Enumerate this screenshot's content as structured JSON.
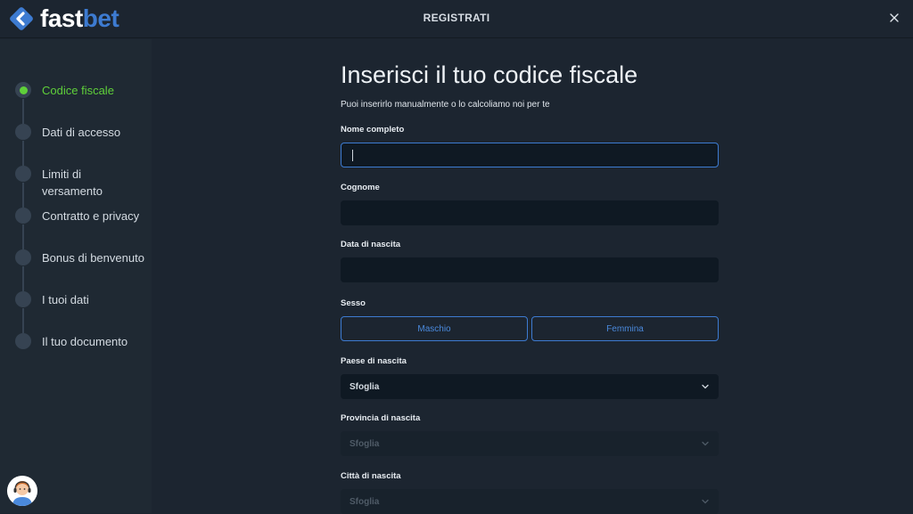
{
  "header": {
    "brand_fast": "fast",
    "brand_bet": "bet",
    "title": "REGISTRATI"
  },
  "steps": [
    {
      "label": "Codice fiscale",
      "active": true
    },
    {
      "label": "Dati di accesso",
      "active": false
    },
    {
      "label": "Limiti di versamento",
      "active": false
    },
    {
      "label": "Contratto e privacy",
      "active": false
    },
    {
      "label": "Bonus di benvenuto",
      "active": false
    },
    {
      "label": "I tuoi dati",
      "active": false
    },
    {
      "label": "Il tuo documento",
      "active": false
    }
  ],
  "form": {
    "heading": "Inserisci il tuo codice fiscale",
    "subheading": "Puoi inserirlo manualmente o lo calcoliamo noi per te",
    "nome_label": "Nome completo",
    "nome_value": "",
    "cognome_label": "Cognome",
    "cognome_value": "",
    "data_label": "Data di nascita",
    "data_value": "",
    "sesso_label": "Sesso",
    "maschio": "Maschio",
    "femmina": "Femmina",
    "paese_label": "Paese di nascita",
    "paese_value": "Sfoglia",
    "provincia_label": "Provincia di nascita",
    "provincia_value": "Sfoglia",
    "citta_label": "Città di nascita",
    "citta_value": "Sfoglia"
  },
  "colors": {
    "accent": "#3d7bd1",
    "active_step": "#5fd03a",
    "background": "#1c2530",
    "input_bg": "#0f1923"
  },
  "icons": {
    "logo": "fastbet-diamond-logo",
    "close": "close-icon",
    "dropdown": "chevron-down-icon",
    "support": "support-agent-icon"
  }
}
